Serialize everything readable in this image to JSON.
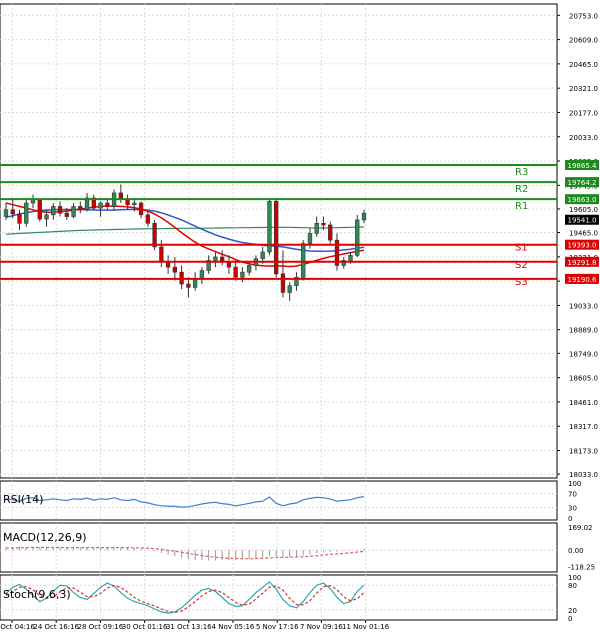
{
  "colors": {
    "background": "#ffffff",
    "grid": "#dcdcdc",
    "axis": "#000000",
    "candle_up": "#2e8b57",
    "candle_down": "#cc0000",
    "ma_fast": "#e60000",
    "ma_slow": "#3355cc",
    "ma_long": "#2e8b57",
    "resistance": "#1e8a1e",
    "support": "#dd0000",
    "rsi": "#3a7fd5",
    "macd": "#e06060",
    "stoch_main": "#2aa8b8",
    "stoch_signal": "#e03030",
    "last_price_bg": "#000000"
  },
  "chart_data": [
    {
      "type": "candlestick",
      "ylim": [
        18033.0,
        20820.0
      ],
      "y_ticks": [
        "20753.0",
        "20609.0",
        "20465.0",
        "20321.0",
        "20177.0",
        "20033.0",
        "19889.0",
        "19745.0",
        "19605.0",
        "19465.0",
        "19321.0",
        "19177.0",
        "19033.0",
        "18889.0",
        "18749.0",
        "18605.0",
        "18461.0",
        "18317.0",
        "18173.0",
        "18033.0"
      ],
      "x_ticks": [
        "22 Oct 04:16",
        "24 Oct 16:16",
        "28 Oct 09:16",
        "30 Oct 01:16",
        "31 Oct 13:16",
        "4 Nov 05:16",
        "5 Nov 17:16",
        "7 Nov 09:16",
        "11 Nov 01:16"
      ],
      "levels": [
        {
          "name": "R3",
          "value": 19865.4,
          "label": "19865.4",
          "kind": "resistance"
        },
        {
          "name": "R2",
          "value": 19764.2,
          "label": "19764.2",
          "kind": "resistance"
        },
        {
          "name": "R1",
          "value": 19663.0,
          "label": "19663.0",
          "kind": "resistance"
        },
        {
          "name": "S1",
          "value": 19393.0,
          "label": "19393.0",
          "kind": "support"
        },
        {
          "name": "S2",
          "value": 19291.8,
          "label": "19291.8",
          "kind": "support"
        },
        {
          "name": "S3",
          "value": 19190.6,
          "label": "19190.6",
          "kind": "support"
        }
      ],
      "last_price": {
        "value": 19541.0,
        "label": "19541.0"
      },
      "candles": [
        {
          "o": 19560,
          "h": 19640,
          "l": 19540,
          "c": 19600
        },
        {
          "o": 19600,
          "h": 19660,
          "l": 19550,
          "c": 19575
        },
        {
          "o": 19575,
          "h": 19600,
          "l": 19480,
          "c": 19520
        },
        {
          "o": 19520,
          "h": 19665,
          "l": 19500,
          "c": 19640
        },
        {
          "o": 19640,
          "h": 19690,
          "l": 19610,
          "c": 19660
        },
        {
          "o": 19660,
          "h": 19670,
          "l": 19530,
          "c": 19545
        },
        {
          "o": 19545,
          "h": 19600,
          "l": 19500,
          "c": 19570
        },
        {
          "o": 19570,
          "h": 19640,
          "l": 19540,
          "c": 19620
        },
        {
          "o": 19620,
          "h": 19650,
          "l": 19560,
          "c": 19580
        },
        {
          "o": 19580,
          "h": 19610,
          "l": 19540,
          "c": 19560
        },
        {
          "o": 19560,
          "h": 19640,
          "l": 19550,
          "c": 19620
        },
        {
          "o": 19620,
          "h": 19650,
          "l": 19580,
          "c": 19600
        },
        {
          "o": 19600,
          "h": 19700,
          "l": 19590,
          "c": 19670
        },
        {
          "o": 19670,
          "h": 19690,
          "l": 19600,
          "c": 19610
        },
        {
          "o": 19610,
          "h": 19650,
          "l": 19560,
          "c": 19640
        },
        {
          "o": 19640,
          "h": 19670,
          "l": 19600,
          "c": 19620
        },
        {
          "o": 19620,
          "h": 19720,
          "l": 19600,
          "c": 19700
        },
        {
          "o": 19700,
          "h": 19750,
          "l": 19640,
          "c": 19660
        },
        {
          "o": 19660,
          "h": 19690,
          "l": 19600,
          "c": 19630
        },
        {
          "o": 19630,
          "h": 19660,
          "l": 19590,
          "c": 19640
        },
        {
          "o": 19640,
          "h": 19650,
          "l": 19550,
          "c": 19570
        },
        {
          "o": 19570,
          "h": 19590,
          "l": 19500,
          "c": 19520
        },
        {
          "o": 19520,
          "h": 19540,
          "l": 19360,
          "c": 19380
        },
        {
          "o": 19380,
          "h": 19420,
          "l": 19260,
          "c": 19290
        },
        {
          "o": 19290,
          "h": 19330,
          "l": 19220,
          "c": 19260
        },
        {
          "o": 19260,
          "h": 19320,
          "l": 19180,
          "c": 19230
        },
        {
          "o": 19230,
          "h": 19270,
          "l": 19130,
          "c": 19160
        },
        {
          "o": 19160,
          "h": 19200,
          "l": 19080,
          "c": 19140
        },
        {
          "o": 19140,
          "h": 19230,
          "l": 19120,
          "c": 19190
        },
        {
          "o": 19190,
          "h": 19260,
          "l": 19160,
          "c": 19240
        },
        {
          "o": 19240,
          "h": 19330,
          "l": 19220,
          "c": 19300
        },
        {
          "o": 19300,
          "h": 19350,
          "l": 19260,
          "c": 19320
        },
        {
          "o": 19320,
          "h": 19360,
          "l": 19270,
          "c": 19290
        },
        {
          "o": 19290,
          "h": 19330,
          "l": 19220,
          "c": 19260
        },
        {
          "o": 19260,
          "h": 19300,
          "l": 19180,
          "c": 19200
        },
        {
          "o": 19200,
          "h": 19260,
          "l": 19170,
          "c": 19230
        },
        {
          "o": 19230,
          "h": 19290,
          "l": 19210,
          "c": 19270
        },
        {
          "o": 19270,
          "h": 19330,
          "l": 19240,
          "c": 19310
        },
        {
          "o": 19310,
          "h": 19380,
          "l": 19280,
          "c": 19350
        },
        {
          "o": 19350,
          "h": 19660,
          "l": 19330,
          "c": 19650
        },
        {
          "o": 19650,
          "h": 19670,
          "l": 19200,
          "c": 19220
        },
        {
          "o": 19220,
          "h": 19360,
          "l": 19080,
          "c": 19110
        },
        {
          "o": 19110,
          "h": 19170,
          "l": 19060,
          "c": 19150
        },
        {
          "o": 19150,
          "h": 19230,
          "l": 19120,
          "c": 19200
        },
        {
          "o": 19200,
          "h": 19420,
          "l": 19180,
          "c": 19400
        },
        {
          "o": 19400,
          "h": 19490,
          "l": 19370,
          "c": 19460
        },
        {
          "o": 19460,
          "h": 19560,
          "l": 19440,
          "c": 19520
        },
        {
          "o": 19520,
          "h": 19560,
          "l": 19480,
          "c": 19510
        },
        {
          "o": 19510,
          "h": 19530,
          "l": 19400,
          "c": 19420
        },
        {
          "o": 19420,
          "h": 19460,
          "l": 19240,
          "c": 19270
        },
        {
          "o": 19270,
          "h": 19320,
          "l": 19250,
          "c": 19300
        },
        {
          "o": 19300,
          "h": 19350,
          "l": 19280,
          "c": 19330
        },
        {
          "o": 19330,
          "h": 19570,
          "l": 19320,
          "c": 19540
        },
        {
          "o": 19540,
          "h": 19600,
          "l": 19520,
          "c": 19580
        }
      ],
      "ma_fast": [
        19640,
        19630,
        19620,
        19610,
        19600,
        19590,
        19585,
        19585,
        19588,
        19592,
        19598,
        19604,
        19610,
        19615,
        19620,
        19622,
        19622,
        19620,
        19617,
        19612,
        19604,
        19592,
        19575,
        19552,
        19525,
        19495,
        19465,
        19435,
        19408,
        19385,
        19368,
        19352,
        19336,
        19322,
        19305,
        19290,
        19280,
        19272,
        19268,
        19266,
        19268,
        19266,
        19264,
        19266,
        19276,
        19288,
        19300,
        19312,
        19322,
        19330,
        19338,
        19346,
        19354,
        19360
      ],
      "ma_slow": [
        19555,
        19565,
        19575,
        19583,
        19590,
        19595,
        19598,
        19600,
        19601,
        19602,
        19602,
        19601,
        19600,
        19599,
        19598,
        19598,
        19598,
        19600,
        19602,
        19602,
        19600,
        19598,
        19592,
        19582,
        19570,
        19555,
        19540,
        19522,
        19503,
        19485,
        19468,
        19452,
        19438,
        19426,
        19415,
        19406,
        19400,
        19395,
        19390,
        19386,
        19385,
        19380,
        19373,
        19366,
        19360,
        19356,
        19354,
        19354,
        19355,
        19358,
        19362,
        19366,
        19372,
        19378
      ],
      "ma_long": [
        19455,
        19457,
        19460,
        19462,
        19464,
        19466,
        19468,
        19470,
        19472,
        19474,
        19476,
        19478,
        19479,
        19480,
        19481,
        19482,
        19483,
        19484,
        19485,
        19486,
        19487,
        19488,
        19488,
        19488,
        19489,
        19489,
        19490,
        19490,
        19490,
        19491,
        19491,
        19492,
        19492,
        19493,
        19493,
        19494,
        19494,
        19495,
        19495,
        19496,
        19496,
        19496,
        19496,
        19495,
        19494,
        19493,
        19492,
        19492,
        19493,
        19494,
        19495,
        19496,
        19497,
        19498
      ]
    },
    {
      "type": "line",
      "title": "RSI(14)",
      "ylim": [
        0,
        100
      ],
      "y_ticks": [
        "100",
        "70",
        "30",
        "0"
      ],
      "values": [
        55,
        52,
        48,
        56,
        58,
        50,
        52,
        55,
        52,
        50,
        55,
        53,
        57,
        51,
        55,
        53,
        58,
        52,
        50,
        53,
        46,
        43,
        38,
        35,
        34,
        33,
        31,
        32,
        36,
        40,
        43,
        45,
        41,
        39,
        35,
        38,
        42,
        46,
        48,
        60,
        42,
        35,
        40,
        43,
        52,
        56,
        59,
        58,
        54,
        48,
        50,
        52,
        58,
        61
      ]
    },
    {
      "type": "bar",
      "title": "MACD(12,26,9)",
      "ylim": [
        -160.0,
        200.0
      ],
      "y_ticks": [
        "169.02",
        "0.00",
        "-118.25"
      ],
      "values": [
        20,
        22,
        24,
        24,
        24,
        22,
        20,
        18,
        18,
        18,
        18,
        18,
        20,
        20,
        20,
        20,
        22,
        20,
        18,
        16,
        10,
        2,
        -8,
        -20,
        -32,
        -44,
        -55,
        -64,
        -70,
        -74,
        -76,
        -76,
        -74,
        -72,
        -70,
        -66,
        -62,
        -58,
        -52,
        -42,
        -42,
        -48,
        -50,
        -46,
        -38,
        -30,
        -22,
        -16,
        -12,
        -10,
        -6,
        -2,
        4,
        10
      ],
      "signal": [
        16,
        17,
        18,
        19,
        20,
        20,
        20,
        20,
        20,
        19,
        19,
        19,
        19,
        19,
        19,
        19,
        19,
        19,
        19,
        18,
        17,
        15,
        11,
        6,
        0,
        -7,
        -15,
        -23,
        -31,
        -39,
        -46,
        -52,
        -56,
        -59,
        -61,
        -62,
        -62,
        -61,
        -59,
        -56,
        -53,
        -52,
        -51,
        -50,
        -48,
        -45,
        -40,
        -35,
        -31,
        -27,
        -23,
        -19,
        -14,
        -9
      ]
    },
    {
      "type": "line",
      "title": "Stoch(9,6,3)",
      "ylim": [
        0,
        100
      ],
      "y_ticks": [
        "100",
        "80",
        "20",
        "0"
      ],
      "values": [
        60,
        75,
        82,
        70,
        55,
        40,
        48,
        65,
        80,
        78,
        62,
        50,
        45,
        60,
        75,
        85,
        78,
        62,
        48,
        40,
        35,
        30,
        22,
        15,
        12,
        15,
        25,
        40,
        55,
        68,
        72,
        65,
        50,
        35,
        28,
        30,
        45,
        62,
        75,
        88,
        70,
        45,
        30,
        25,
        40,
        62,
        80,
        85,
        72,
        50,
        35,
        40,
        65,
        80
      ],
      "signal": [
        55,
        65,
        75,
        76,
        69,
        55,
        48,
        51,
        64,
        74,
        73,
        63,
        52,
        52,
        60,
        73,
        79,
        75,
        63,
        50,
        41,
        35,
        29,
        22,
        16,
        14,
        17,
        27,
        40,
        54,
        65,
        68,
        62,
        50,
        38,
        31,
        34,
        46,
        61,
        75,
        78,
        68,
        48,
        33,
        32,
        42,
        61,
        76,
        79,
        69,
        52,
        42,
        47,
        62
      ]
    }
  ]
}
